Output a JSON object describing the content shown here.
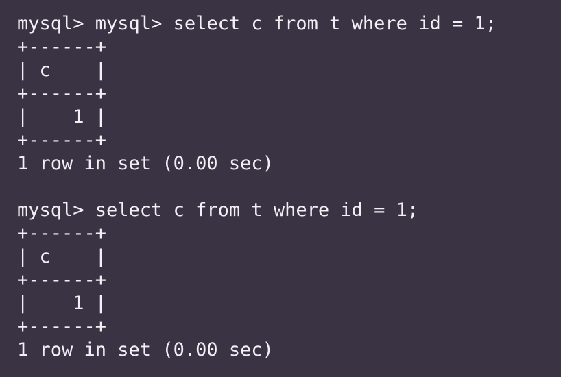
{
  "terminal": {
    "lines": [
      "mysql> mysql> select c from t where id = 1;",
      "+------+",
      "| c    |",
      "+------+",
      "|    1 |",
      "+------+",
      "1 row in set (0.00 sec)",
      "",
      "mysql> select c from t where id = 1;",
      "+------+",
      "| c    |",
      "+------+",
      "|    1 |",
      "+------+",
      "1 row in set (0.00 sec)"
    ]
  },
  "colors": {
    "background": "#3a3344",
    "text": "#f2f0f5"
  }
}
